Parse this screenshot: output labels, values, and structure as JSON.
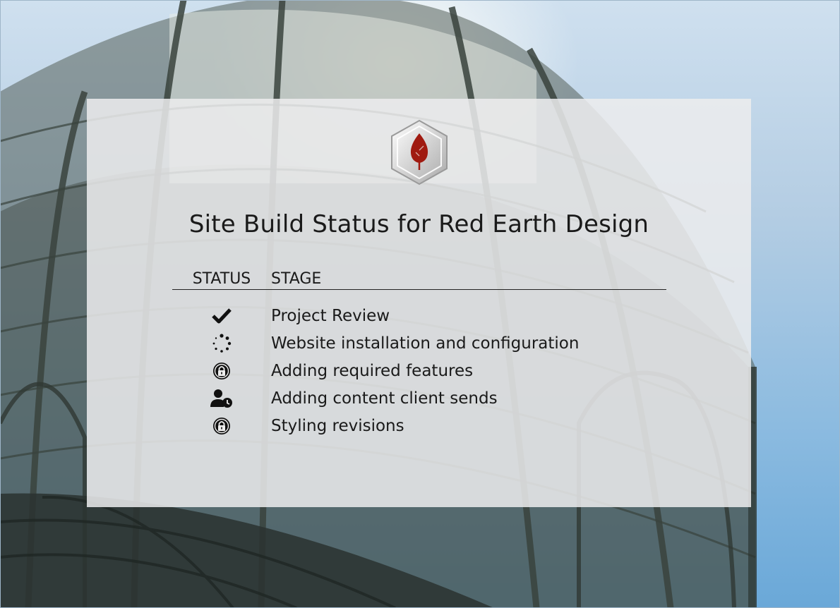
{
  "page": {
    "title": "Site Build Status for Red Earth Design"
  },
  "logo": {
    "icon": "leaf-hexagon-logo",
    "accent_color": "#a01a10"
  },
  "table": {
    "headers": {
      "status": "STATUS",
      "stage": "STAGE"
    },
    "rows": [
      {
        "status_icon": "check-icon",
        "stage": "Project Review"
      },
      {
        "status_icon": "spinner-icon",
        "stage": "Website installation and configuration"
      },
      {
        "status_icon": "lock-icon",
        "stage": "Adding required features"
      },
      {
        "status_icon": "user-clock-icon",
        "stage": "Adding content client sends"
      },
      {
        "status_icon": "lock-icon",
        "stage": "Styling revisions"
      }
    ]
  }
}
